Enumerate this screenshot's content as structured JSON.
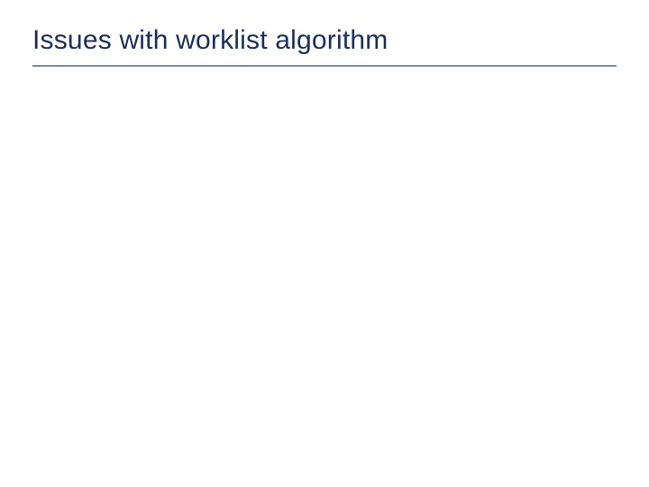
{
  "slide": {
    "title": "Issues with worklist algorithm"
  }
}
